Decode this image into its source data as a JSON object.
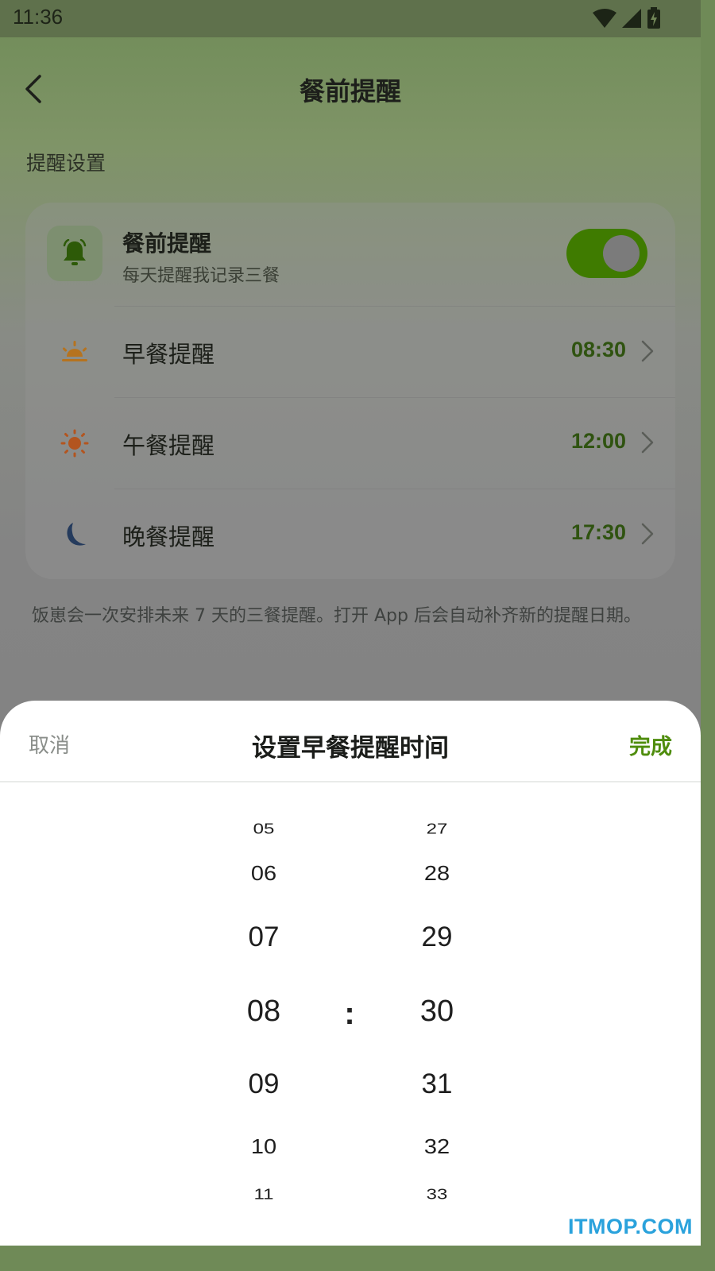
{
  "status_bar": {
    "time": "11:36",
    "icons": [
      "wifi-icon",
      "signal-icon",
      "battery-charging-icon"
    ]
  },
  "header": {
    "title": "餐前提醒",
    "back_icon": "chevron-left-icon"
  },
  "section_label": "提醒设置",
  "main_setting": {
    "title": "餐前提醒",
    "subtitle": "每天提醒我记录三餐",
    "icon": "bell-icon",
    "enabled": true
  },
  "meals": [
    {
      "label": "早餐提醒",
      "time": "08:30",
      "icon": "sunrise-icon",
      "icon_color": "#b6731f"
    },
    {
      "label": "午餐提醒",
      "time": "12:00",
      "icon": "sun-icon",
      "icon_color": "#b3551f"
    },
    {
      "label": "晚餐提醒",
      "time": "17:30",
      "icon": "moon-icon",
      "icon_color": "#253b5d"
    }
  ],
  "footnote": "饭崽会一次安排未来 7 天的三餐提醒。打开 App 后会自动补齐新的提醒日期。",
  "sheet": {
    "cancel_label": "取消",
    "title": "设置早餐提醒时间",
    "done_label": "完成",
    "colon": ":",
    "hours": [
      "05",
      "06",
      "07",
      "08",
      "09",
      "10",
      "11"
    ],
    "minutes": [
      "27",
      "28",
      "29",
      "30",
      "31",
      "32",
      "33"
    ],
    "selected_hour": "08",
    "selected_minute": "30"
  },
  "watermark": "ITMOP.COM",
  "colors": {
    "accent": "#4f8d0d",
    "toggle_on": "#3f7b00",
    "time_text": "#2f5310"
  }
}
